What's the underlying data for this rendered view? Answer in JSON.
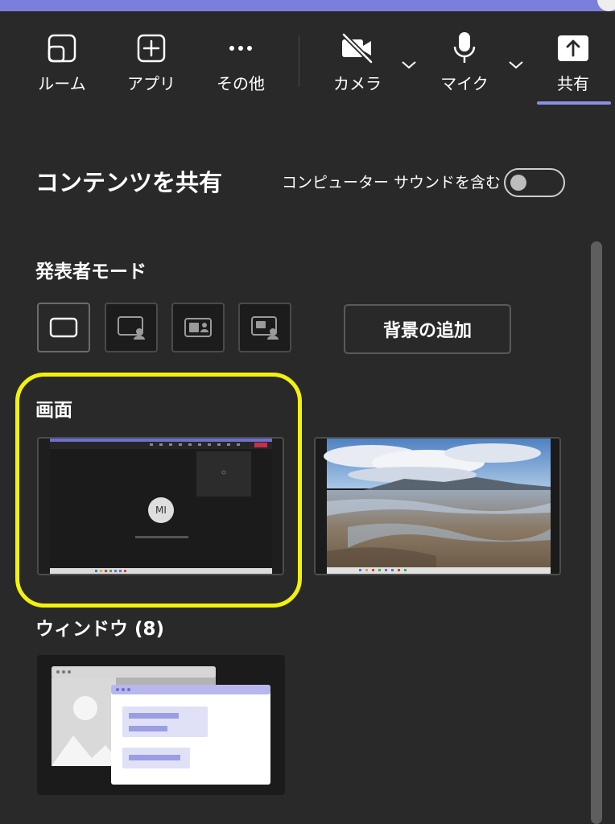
{
  "toolbar": {
    "items": [
      {
        "label": "ルーム",
        "icon": "room-icon"
      },
      {
        "label": "アプリ",
        "icon": "apps-plus-icon"
      },
      {
        "label": "その他",
        "icon": "more-icon"
      },
      {
        "label": "カメラ",
        "icon": "camera-off-icon"
      },
      {
        "label": "マイク",
        "icon": "microphone-icon"
      },
      {
        "label": "共有",
        "icon": "share-icon"
      }
    ],
    "active": "共有"
  },
  "share_panel": {
    "title": "コンテンツを共有",
    "computer_sound_label": "コンピューター サウンドを含む",
    "computer_sound_on": false
  },
  "presenter_mode": {
    "title": "発表者モード",
    "modes": [
      "content-only",
      "standout",
      "side-by-side",
      "reporter"
    ],
    "selected": "content-only",
    "add_background_label": "背景の追加"
  },
  "screen": {
    "title": "画面",
    "thumb1": {
      "avatar": "MI"
    },
    "thumb2": {
      "type": "desktop-wallpaper"
    }
  },
  "windows": {
    "title": "ウィンドウ (8)"
  },
  "colors": {
    "background": "#292929",
    "accent": "#7b7fdc",
    "highlight": "#f2f20a",
    "meeting_end": "#c4314b"
  }
}
